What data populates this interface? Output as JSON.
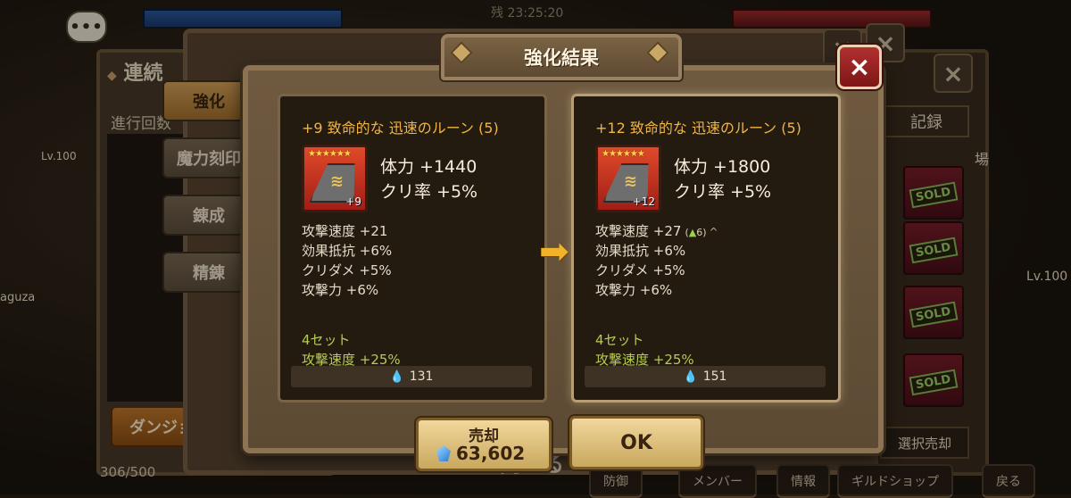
{
  "hud": {
    "timer": "残 23:25:20",
    "chat_icon": "chat-bubble-icon"
  },
  "back_screen": {
    "title": "連続",
    "progress_label": "進行回数",
    "dungeon_button": "ダンジョ",
    "capacity": "306/500",
    "left_level": "Lv.100",
    "left_name": "aguza",
    "tabs": [
      "強化",
      "魔力刻印",
      "錬成",
      "精錬"
    ],
    "record_button": "記録",
    "venue_text": "場",
    "sold_label": "SOLD",
    "select_sell_button": "選択売却",
    "close_label": "閉じる",
    "bottom_nav": [
      "防御",
      "メンバー",
      "情報",
      "ギルドショップ",
      "戻る"
    ],
    "right_level": "Lv.100"
  },
  "dialog": {
    "title": "強化結果",
    "close_icon": "close-x-icon"
  },
  "rune_before": {
    "name": "+9 致命的な 迅速のルーン (5)",
    "level_badge": "+9",
    "stars": "★★★★★★",
    "main_stats": [
      "体力 +1440",
      "クリ率 +5%"
    ],
    "sub_stats": [
      "攻撃速度 +21",
      "効果抵抗 +6%",
      "クリダメ +5%",
      "攻撃力 +6%"
    ],
    "set_name": "4セット",
    "set_bonus": "攻撃速度 +25%",
    "mana": "131"
  },
  "rune_after": {
    "name": "+12 致命的な 迅速のルーン (5)",
    "level_badge": "+12",
    "stars": "★★★★★★",
    "main_stats": [
      "体力 +1800",
      "クリ率 +5%"
    ],
    "sub_stats": [
      "攻撃速度 +27",
      "効果抵抗 +6%",
      "クリダメ +5%",
      "攻撃力 +6%"
    ],
    "upgrade_amount": "6",
    "set_name": "4セット",
    "set_bonus": "攻撃速度 +25%",
    "mana": "151"
  },
  "buttons": {
    "sell_label": "売却",
    "sell_price": "63,602",
    "ok_label": "OK"
  }
}
